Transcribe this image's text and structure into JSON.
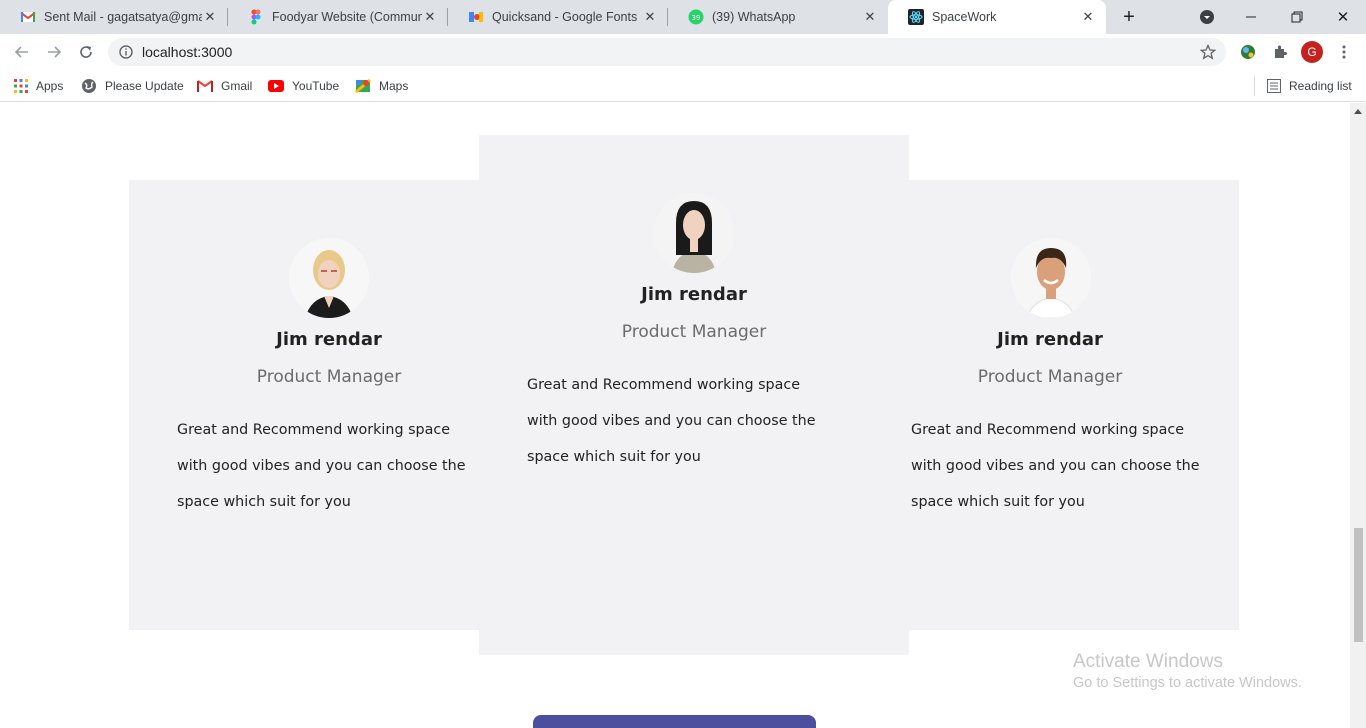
{
  "browser": {
    "tabs": [
      {
        "title": "Sent Mail - gagatsatya@gmail.com",
        "icon": "gmail-icon"
      },
      {
        "title": "Foodyar Website (Community)",
        "icon": "figma-icon"
      },
      {
        "title": "Quicksand - Google Fonts",
        "icon": "google-fonts-icon"
      },
      {
        "title": "(39) WhatsApp",
        "icon": "whatsapp-icon",
        "badge": "39"
      },
      {
        "title": "SpaceWork",
        "icon": "react-icon",
        "active": true
      }
    ],
    "url": "localhost:3000",
    "profile_initial": "G",
    "bookmarks": [
      {
        "label": "Apps",
        "icon": "apps-grid-icon"
      },
      {
        "label": "Please Update",
        "icon": "globe-icon"
      },
      {
        "label": "Gmail",
        "icon": "gmail-icon"
      },
      {
        "label": "YouTube",
        "icon": "youtube-icon"
      },
      {
        "label": "Maps",
        "icon": "maps-icon"
      }
    ],
    "reading_list": "Reading list"
  },
  "testimonials": [
    {
      "name": "Jim rendar",
      "role": "Product Manager",
      "quote": "Great and Recommend working space with good vibes and you can choose the space which suit for you"
    },
    {
      "name": "Jim rendar",
      "role": "Product Manager",
      "quote": "Great and Recommend working space with good vibes and you can choose the space which suit for you"
    },
    {
      "name": "Jim rendar",
      "role": "Product Manager",
      "quote": "Great and Recommend working space with good vibes and you can choose the space which suit for you"
    }
  ],
  "watermark": {
    "title": "Activate Windows",
    "subtitle": "Go to Settings to activate Windows."
  },
  "colors": {
    "card_bg": "#f2f2f4",
    "cta": "#4b4f9e",
    "tabstrip": "#dee1e6"
  }
}
